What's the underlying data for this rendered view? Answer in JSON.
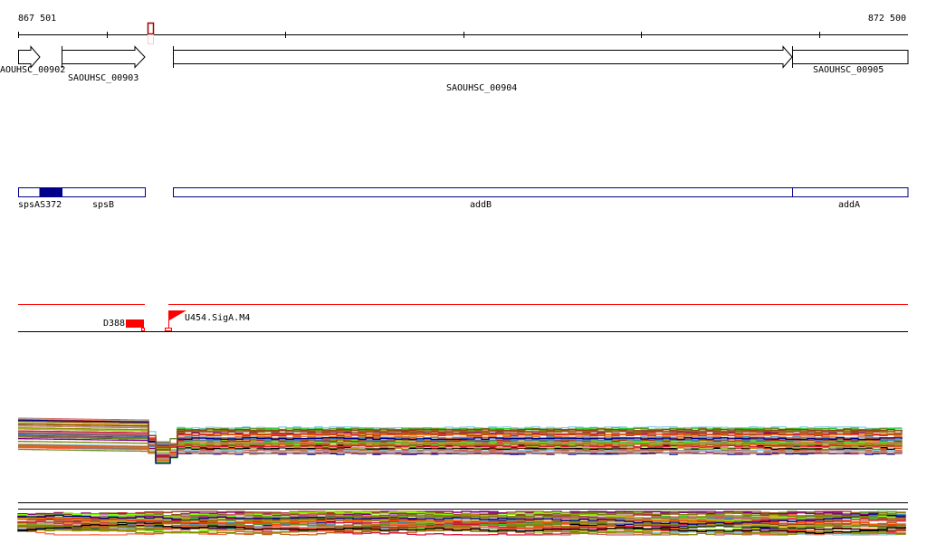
{
  "ruler": {
    "start_label": "867 501",
    "end_label": "872 500"
  },
  "genes": [
    {
      "label": "AOUHSC_00902"
    },
    {
      "label": "SAOUHSC_00903"
    },
    {
      "label": "SAOUHSC_00904"
    },
    {
      "label": "SAOUHSC_00905"
    }
  ],
  "names_track": [
    {
      "label": "spsAS372"
    },
    {
      "label": "spsB"
    },
    {
      "label": "addB"
    },
    {
      "label": "addA"
    }
  ],
  "features": [
    {
      "label": "D388"
    },
    {
      "label": "U454.SigA.M4"
    }
  ],
  "colors": {
    "feature_red": "#ff0000",
    "name_track_blue": "#00008b",
    "cursor": "#a00000",
    "trace_palette": [
      "#c0601a",
      "#8b8b00",
      "#7fff00",
      "#b22222",
      "#000000",
      "#ff6347",
      "#9acd32",
      "#808000",
      "#cd5c5c",
      "#800080",
      "#87ceeb",
      "#daa520",
      "#4682b4",
      "#d2691e",
      "#ff4500",
      "#32cd32",
      "#a0522d",
      "#6b8e23",
      "#dc143c",
      "#bc8f8f",
      "#00008b",
      "#8b4513"
    ]
  }
}
